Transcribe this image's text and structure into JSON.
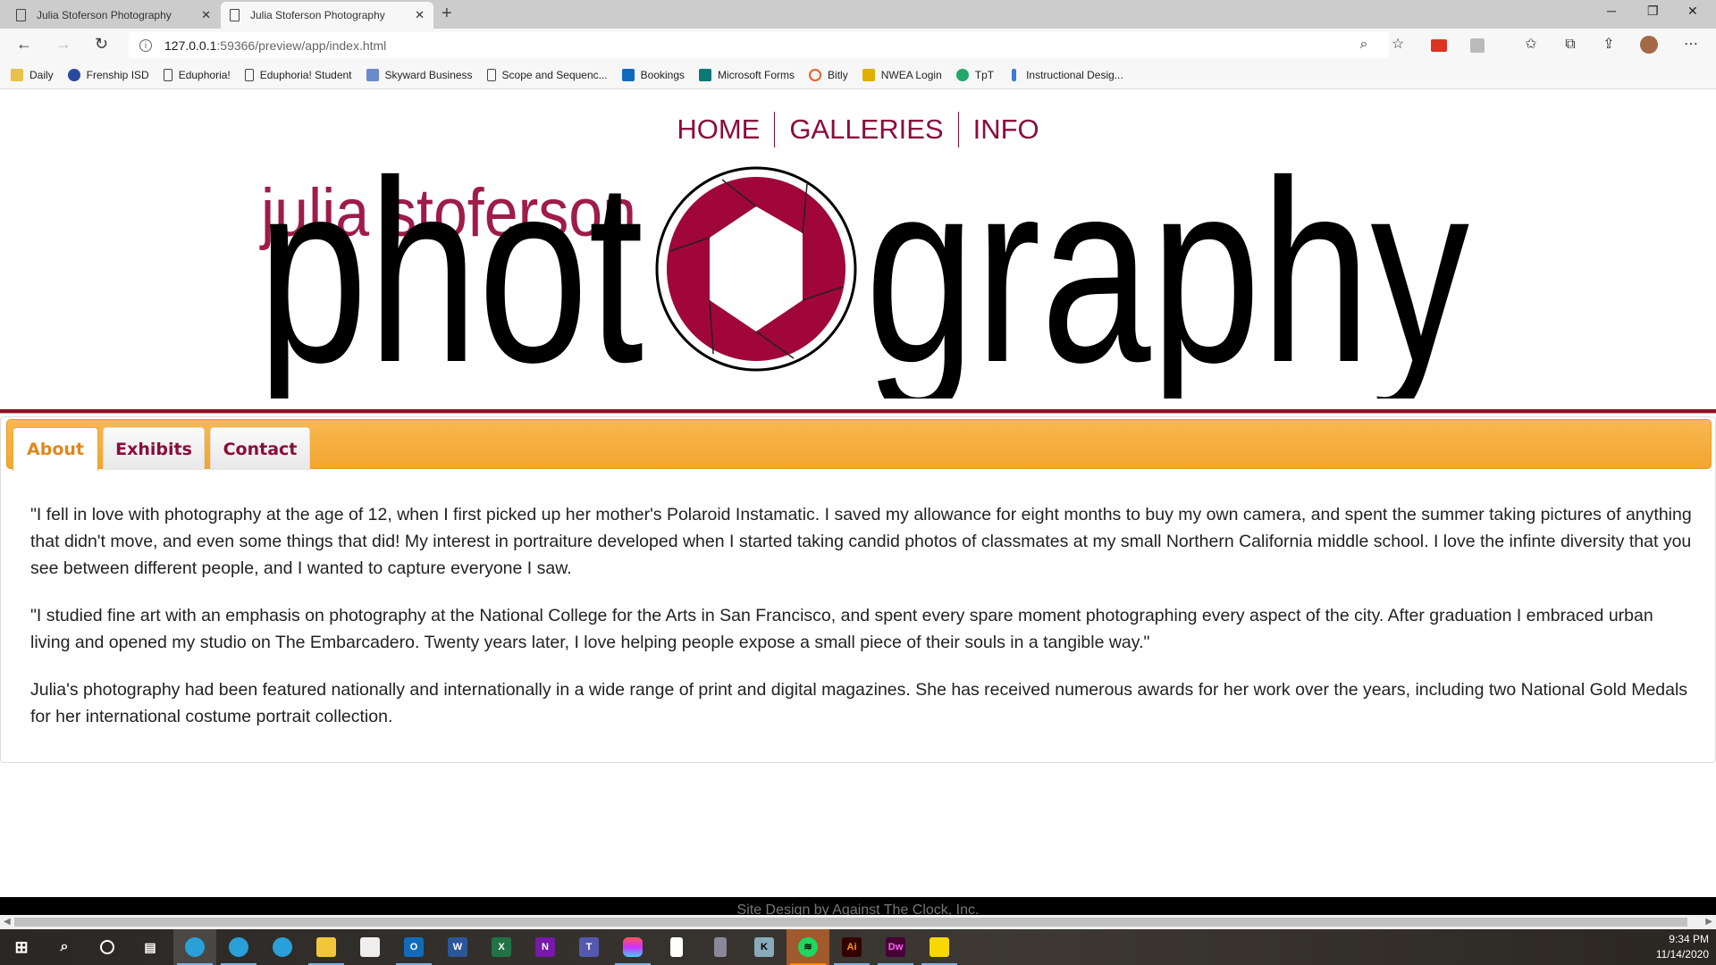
{
  "browser": {
    "tabs": [
      {
        "title": "Julia Stoferson Photography",
        "active": false
      },
      {
        "title": "Julia Stoferson Photography",
        "active": true
      }
    ],
    "url_host": "127.0.0.1",
    "url_rest": ":59366/preview/app/index.html",
    "bookmarks": [
      "Daily",
      "Frenship ISD",
      "Eduphoria!",
      "Eduphoria! Student",
      "Skyward Business",
      "Scope and Sequenc...",
      "Bookings",
      "Microsoft Forms",
      "Bitly",
      "NWEA Login",
      "TpT",
      "Instructional Desig..."
    ]
  },
  "site": {
    "nav": [
      "HOME",
      "GALLERIES",
      "INFO"
    ],
    "logo": {
      "top": "julia stoferson",
      "left": "phot",
      "right": "graphy"
    },
    "colors": {
      "maroon": "#8b0c3a",
      "orange": "#f3a52f"
    },
    "tabs": [
      "About",
      "Exhibits",
      "Contact"
    ],
    "active_tab": "About",
    "paragraphs": [
      "\"I fell in love with photography at the age of 12, when I first picked up her mother's Polaroid Instamatic. I saved my allowance for eight months to buy my own camera, and spent the summer taking pictures of anything that didn't move, and even some things that did! My interest in portraiture developed when I started taking candid photos of classmates at my small Northern California middle school. I love the infinte diversity that you see between different people, and I wanted to capture everyone I saw.",
      "\"I studied fine art with an emphasis on photography at the National College for the Arts in San Francisco, and spent every spare moment photographing every aspect of the city. After graduation I embraced urban living and opened my studio on The Embarcadero. Twenty years later, I love helping people expose a small piece of their souls in a tangible way.\"",
      "Julia's photography had been featured nationally and internationally in a wide range of print and digital magazines. She has received numerous awards for her work over the years, including two National Gold Medals for her international costume portrait collection."
    ],
    "footer": "Site Design by Against The Clock, Inc."
  },
  "taskbar": {
    "time": "9:34 PM",
    "date": "11/14/2020"
  }
}
